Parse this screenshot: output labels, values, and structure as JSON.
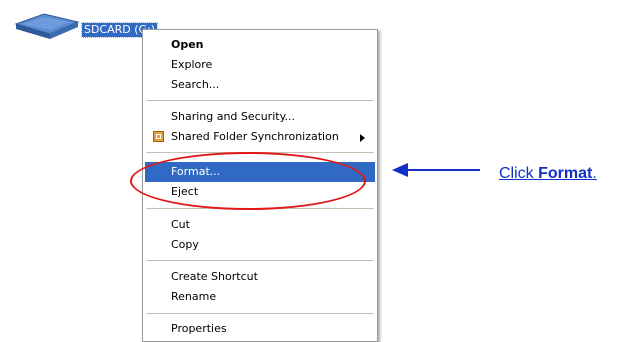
{
  "drive": {
    "label": "SDCARD (G:)",
    "icon": "drive-icon",
    "color": "#4a78b8"
  },
  "menu": {
    "items": [
      {
        "label": "Open",
        "bold": true
      },
      {
        "label": "Explore"
      },
      {
        "label": "Search..."
      },
      {
        "label": "Sharing and Security..."
      },
      {
        "label": "Shared Folder Synchronization",
        "icon": "sync-icon",
        "submenu": true
      },
      {
        "label": "Format...",
        "highlighted": true
      },
      {
        "label": "Eject"
      },
      {
        "label": "Cut"
      },
      {
        "label": "Copy"
      },
      {
        "label": "Create Shortcut"
      },
      {
        "label": "Rename"
      },
      {
        "label": "Properties"
      }
    ],
    "highlight_color": "#316ac5"
  },
  "callout": {
    "instruction_prefix": "Click ",
    "instruction_bold": "Format",
    "instruction_suffix": ".",
    "ring_color": "#e01818",
    "arrow_color": "#1030c8",
    "text_color": "#1030c8"
  }
}
